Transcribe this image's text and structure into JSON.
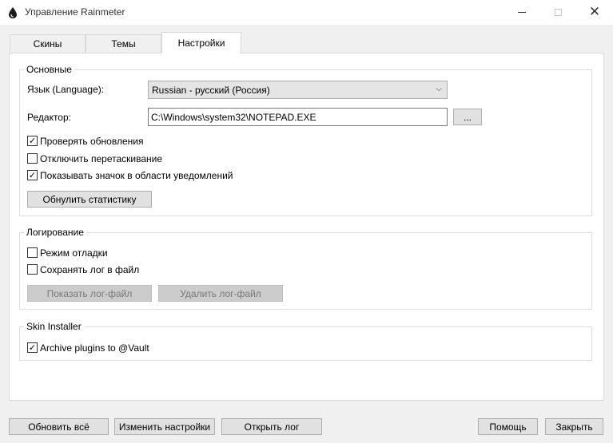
{
  "window": {
    "title": "Управление Rainmeter",
    "icon": "rainmeter-drop-icon",
    "close_glyph": "✕"
  },
  "tabs": [
    {
      "label": "Скины",
      "active": false
    },
    {
      "label": "Темы",
      "active": false
    },
    {
      "label": "Настройки",
      "active": true
    }
  ],
  "general": {
    "legend": "Основные",
    "language_label": "Язык (Language):",
    "language_value": "Russian - русский (Россия)",
    "editor_label": "Редактор:",
    "editor_value": "C:\\Windows\\system32\\NOTEPAD.EXE",
    "browse_label": "...",
    "check_updates": {
      "label": "Проверять обновления",
      "checked": true
    },
    "disable_drag": {
      "label": "Отключить перетаскивание",
      "checked": false
    },
    "show_tray": {
      "label": "Показывать значок в области уведомлений",
      "checked": true
    },
    "reset_stats_label": "Обнулить статистику"
  },
  "logging": {
    "legend": "Логирование",
    "debug_mode": {
      "label": "Режим отладки",
      "checked": false
    },
    "save_log": {
      "label": "Сохранять лог в файл",
      "checked": false
    },
    "show_log_label": "Показать лог-файл",
    "delete_log_label": "Удалить лог-файл"
  },
  "skin_installer": {
    "legend": "Skin Installer",
    "archive_plugins": {
      "label": "Archive plugins to @Vault",
      "checked": true
    }
  },
  "footer": {
    "refresh_all": "Обновить всё",
    "edit_settings": "Изменить настройки",
    "open_log": "Открыть лог",
    "help": "Помощь",
    "close": "Закрыть"
  },
  "check_glyph": "✓",
  "combo_arrow_glyph": "⌵"
}
